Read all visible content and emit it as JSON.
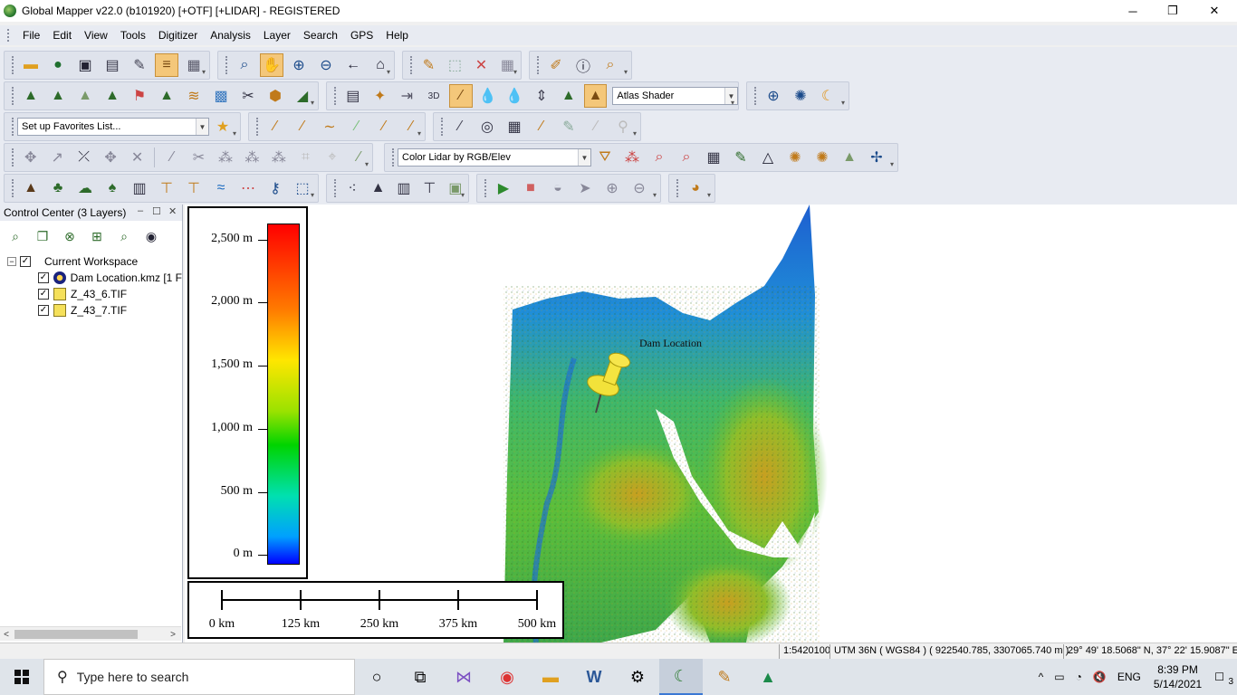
{
  "window": {
    "title": "Global Mapper v22.0 (b101920) [+OTF] [+LIDAR] - REGISTERED",
    "minimize_glyph": "─",
    "restore_glyph": "❐",
    "close_glyph": "✕"
  },
  "menu": [
    "File",
    "Edit",
    "View",
    "Tools",
    "Digitizer",
    "Analysis",
    "Layer",
    "Search",
    "GPS",
    "Help"
  ],
  "toolbar": {
    "shader_combo": "Atlas Shader",
    "favorites_combo": "Set up Favorites List...",
    "lidar_combo": "Color Lidar by RGB/Elev"
  },
  "control_center": {
    "title": "Control Center (3 Layers)",
    "pin_glyph": "‒",
    "float_glyph": "☐",
    "close_glyph": "✕",
    "workspace": "Current Workspace",
    "layers": [
      {
        "name": "Dam Location.kmz [1 F",
        "checked": true,
        "icon": "kmz-globe-icon"
      },
      {
        "name": "Z_43_6.TIF",
        "checked": true,
        "icon": "elevation-grid-icon"
      },
      {
        "name": "Z_43_7.TIF",
        "checked": true,
        "icon": "elevation-grid-icon"
      }
    ]
  },
  "map": {
    "legend_labels": [
      "2,500 m",
      "2,000 m",
      "1,500 m",
      "1,000 m",
      "500 m",
      "0 m"
    ],
    "scale_labels": [
      "0 km",
      "125 km",
      "250 km",
      "375 km",
      "500 km"
    ],
    "placemark_label": "Dam Location"
  },
  "status": {
    "scale": "1:5420100",
    "projection": "UTM 36N ( WGS84 ) ( 922540.785, 3307065.740 m )",
    "latlon": "29° 49' 18.5068\" N, 37° 22' 15.9087\" E"
  },
  "taskbar": {
    "search_placeholder": "Type here to search",
    "language": "ENG",
    "time": "8:39 PM",
    "date": "5/14/2021",
    "notifications": "3"
  },
  "colors": {
    "toolbar_bg": "#e8ebf2",
    "accent_active": "#f4c77a",
    "taskbar_bg": "#dfe4ea"
  }
}
